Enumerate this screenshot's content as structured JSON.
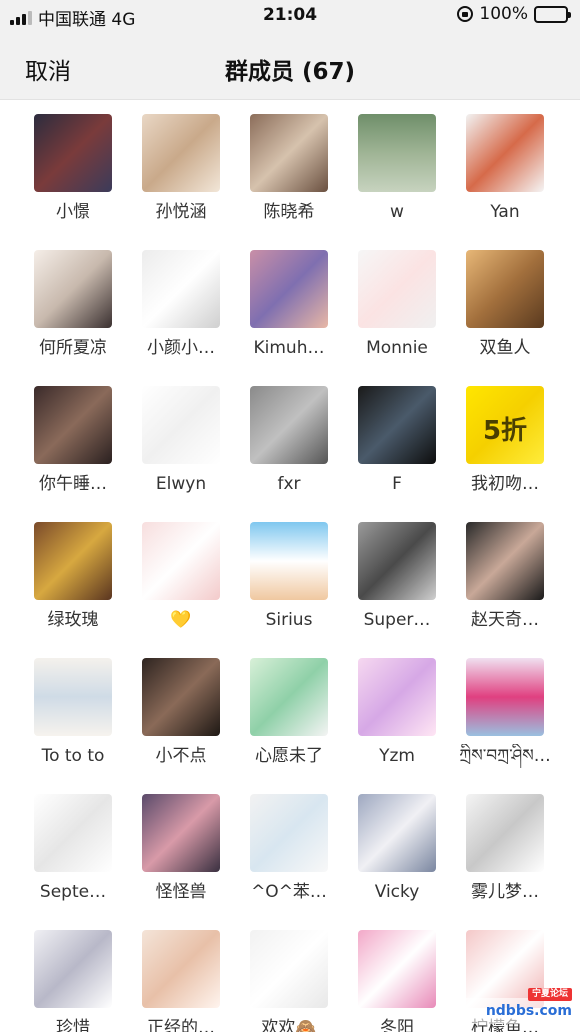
{
  "status_bar": {
    "carrier": "中国联通 4G",
    "time": "21:04",
    "battery": "100%"
  },
  "nav": {
    "cancel": "取消",
    "title": "群成员 (67)"
  },
  "members": [
    {
      "name": "小憬",
      "bg": "linear-gradient(135deg,#2c2c3e,#7a3b3b,#3b3b5a)",
      "glyph": ""
    },
    {
      "name": "孙悦涵",
      "bg": "linear-gradient(135deg,#e9d7c5,#c9a98a,#f2e6d8)",
      "glyph": ""
    },
    {
      "name": "陈晓希",
      "bg": "linear-gradient(135deg,#8b6d5a,#d6c2ad,#6a5040)",
      "glyph": ""
    },
    {
      "name": "w",
      "bg": "linear-gradient(180deg,#6f8f6a,#9fb495,#c7d3bf)",
      "glyph": ""
    },
    {
      "name": "Yan",
      "bg": "linear-gradient(135deg,#f2f2f2,#d66a4a,#f5f5f5)",
      "glyph": ""
    },
    {
      "name": "何所夏凉",
      "bg": "linear-gradient(135deg,#f5eee8,#c8b9ad,#3a3030)",
      "glyph": ""
    },
    {
      "name": "小颜小…",
      "bg": "linear-gradient(135deg,#ececec,#ffffff,#cfcfcf)",
      "glyph": ""
    },
    {
      "name": "Kimuh…",
      "bg": "linear-gradient(135deg,#c98fa7,#7f6fb0,#e8b7a6)",
      "glyph": ""
    },
    {
      "name": "Monnie",
      "bg": "linear-gradient(135deg,#f6f6f6,#fbe3e3,#f0f0f0)",
      "glyph": ""
    },
    {
      "name": "双鱼人",
      "bg": "linear-gradient(135deg,#e7b777,#a3703d,#5a3a1f)",
      "glyph": ""
    },
    {
      "name": "你午睡…",
      "bg": "linear-gradient(135deg,#3a2a2a,#8a6a5a,#2a2020)",
      "glyph": ""
    },
    {
      "name": "Elwyn",
      "bg": "linear-gradient(135deg,#ffffff,#f0f0f0,#ffffff)",
      "glyph": ""
    },
    {
      "name": "fxr",
      "bg": "linear-gradient(135deg,#8a8a8a,#c0c0c0,#555)",
      "glyph": ""
    },
    {
      "name": "F",
      "bg": "linear-gradient(135deg,#1a1a1a,#4a5a6a,#0d0d0d)",
      "glyph": ""
    },
    {
      "name": "我初吻…",
      "bg": "linear-gradient(135deg,#ffe600,#f5d000,#ffec3b)",
      "glyph": "5折",
      "glyph_dark": true
    },
    {
      "name": "绿玫瑰",
      "bg": "linear-gradient(135deg,#7a4a2a,#d7a840,#5a3520)",
      "glyph": ""
    },
    {
      "name": "💛",
      "bg": "linear-gradient(135deg,#f7dede,#ffffff,#f3caca)",
      "glyph": ""
    },
    {
      "name": "Sirius",
      "bg": "linear-gradient(180deg,#7fc7ef,#ffffff,#f0c8a0)",
      "glyph": ""
    },
    {
      "name": "Super…",
      "bg": "linear-gradient(135deg,#9a9a9a,#4a4a4a,#d0d0d0)",
      "glyph": ""
    },
    {
      "name": "赵天奇…",
      "bg": "linear-gradient(135deg,#2a2a2a,#c8a898,#1a1a1a)",
      "glyph": ""
    },
    {
      "name": "To to to",
      "bg": "linear-gradient(180deg,#f4f1ec,#cfdbe6,#f6f3ee)",
      "glyph": ""
    },
    {
      "name": "小不点",
      "bg": "linear-gradient(135deg,#2e2420,#8a6a58,#1e1814)",
      "glyph": ""
    },
    {
      "name": "心愿未了",
      "bg": "linear-gradient(135deg,#d8f0d8,#8fd0a8,#f4f4f4)",
      "glyph": ""
    },
    {
      "name": "Yzm",
      "bg": "linear-gradient(135deg,#f6d8f0,#d6a8e6,#ffe6f4)",
      "glyph": ""
    },
    {
      "name": "ཀྲིས་བཀྲ་ཤིས…",
      "bg": "linear-gradient(180deg,#f0e0f0,#e04080,#9ac0e0)",
      "glyph": ""
    },
    {
      "name": "Septe…",
      "bg": "linear-gradient(135deg,#ffffff,#e6e6e6,#ffffff)",
      "glyph": ""
    },
    {
      "name": "怪怪兽",
      "bg": "linear-gradient(135deg,#5a4a6a,#d89aa8,#3a3040)",
      "glyph": ""
    },
    {
      "name": "^O^苯…",
      "bg": "linear-gradient(135deg,#f2f2f2,#d8e6f0,#f8f8f8)",
      "glyph": ""
    },
    {
      "name": "Vicky",
      "bg": "linear-gradient(135deg,#9ea8c0,#f0f0f4,#7a86a0)",
      "glyph": ""
    },
    {
      "name": "雾儿梦…",
      "bg": "linear-gradient(135deg,#f4f4f4,#c8c8c8,#ffffff)",
      "glyph": ""
    },
    {
      "name": "珍惜",
      "bg": "linear-gradient(135deg,#f0f0f4,#b8b8c8,#ffffff)",
      "glyph": ""
    },
    {
      "name": "正经的…",
      "bg": "linear-gradient(135deg,#f4e4d8,#e8c0a8,#fff4ee)",
      "glyph": ""
    },
    {
      "name": "欢欢🙈",
      "bg": "linear-gradient(135deg,#f2f2f2,#ffffff,#e8e8e8)",
      "glyph": ""
    },
    {
      "name": "冬阳",
      "bg": "linear-gradient(135deg,#f2a8c8,#ffffff,#e88ab8)",
      "glyph": ""
    },
    {
      "name": "柠檬鱼…",
      "bg": "linear-gradient(135deg,#f4c8c8,#ffffff,#f0b0b0)",
      "glyph": ""
    }
  ],
  "watermark": {
    "text": "ndbbs.com",
    "badge": "宁夏论坛"
  }
}
